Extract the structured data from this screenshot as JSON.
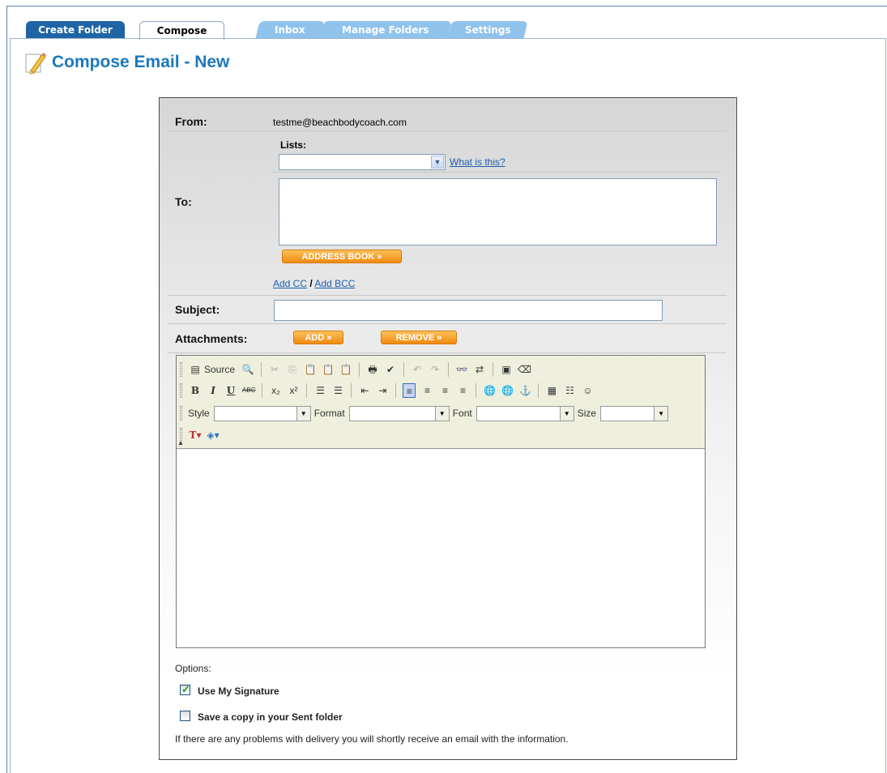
{
  "tabs": [
    {
      "label": "Create Folder"
    },
    {
      "label": "Compose"
    },
    {
      "label": "Inbox"
    },
    {
      "label": "Manage Folders"
    },
    {
      "label": "Settings"
    }
  ],
  "page_title": "Compose Email - New",
  "from": {
    "label": "From:",
    "value": "testme@beachbodycoach.com"
  },
  "lists": {
    "label": "Lists:",
    "selected": "",
    "help_link": "What is this?"
  },
  "to": {
    "label": "To:",
    "value": "",
    "address_book_button": "ADDRESS BOOK »"
  },
  "cc_bcc": {
    "add_cc": "Add CC",
    "slash": "/",
    "add_bcc": "Add BCC"
  },
  "subject": {
    "label": "Subject:",
    "value": ""
  },
  "attachments": {
    "label": "Attachments:",
    "add_button": "ADD »",
    "remove_button": "REMOVE »"
  },
  "editor": {
    "source_label": "Source",
    "style_label": "Style",
    "format_label": "Format",
    "font_label": "Font",
    "size_label": "Size",
    "style_value": "",
    "format_value": "",
    "font_value": "",
    "size_value": "",
    "body": ""
  },
  "options": {
    "label": "Options:",
    "use_signature": {
      "label": "Use My Signature",
      "checked": true
    },
    "save_copy": {
      "label": "Save a copy in your Sent folder",
      "checked": false
    },
    "delivery_note": "If there are any problems with delivery you will shortly receive an email with the information."
  },
  "colors": {
    "tab_dark": "#1f65a6",
    "tab_light": "#8fc3ec",
    "title": "#1b78bd",
    "orange": "#f08a10",
    "link": "#1a5fb0"
  }
}
